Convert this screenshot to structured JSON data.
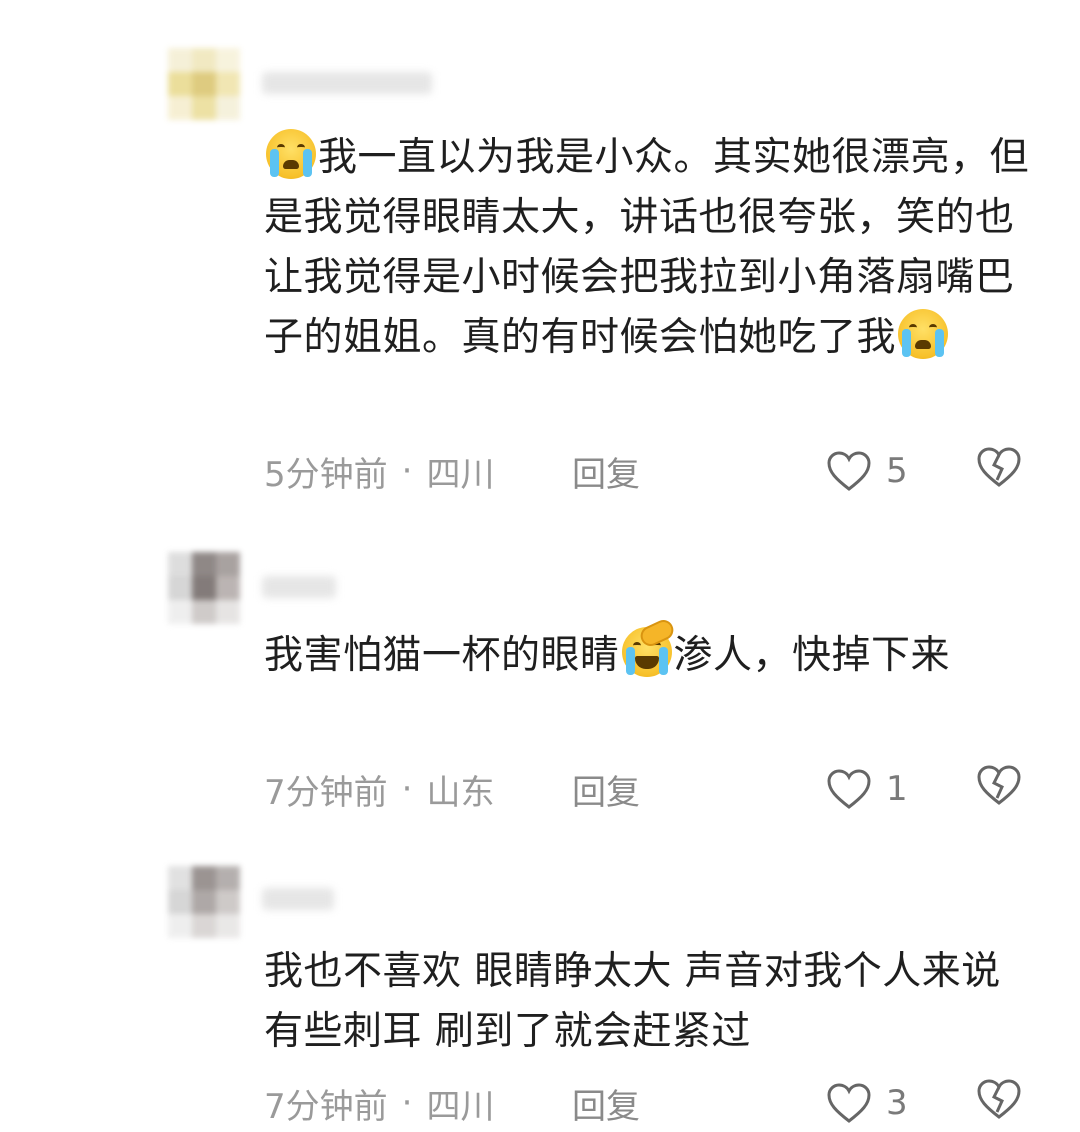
{
  "comments": [
    {
      "text_parts": [
        "",
        "我一直以为我是小众。其实她很漂亮，但是我觉得眼睛太大，讲话也很夸张，笑的也让我觉得是小时候会把我拉到小角落扇嘴巴子的姐姐。真的有时候会怕她吃了我",
        ""
      ],
      "emoji": "loudly-crying-face",
      "time": "5分钟前",
      "separator": "·",
      "location": "四川",
      "reply_label": "回复",
      "like_count": "5"
    },
    {
      "text_parts": [
        "我害怕猫一杯的眼睛",
        "渗人，快掉下来"
      ],
      "emoji": "rolling-on-floor-laughing",
      "time": "7分钟前",
      "separator": "·",
      "location": "山东",
      "reply_label": "回复",
      "like_count": "1"
    },
    {
      "text": "我也不喜欢 眼睛睁太大 声音对我个人来说有些刺耳 刷到了就会赶紧过",
      "time": "7分钟前",
      "separator": "·",
      "location": "四川",
      "reply_label": "回复",
      "like_count": "3"
    }
  ],
  "icons": {
    "like": "heart-outline-icon",
    "dislike": "broken-heart-icon"
  },
  "colors": {
    "meta": "#9a9a9a",
    "text": "#1f1f1f",
    "icon": "#666666"
  }
}
